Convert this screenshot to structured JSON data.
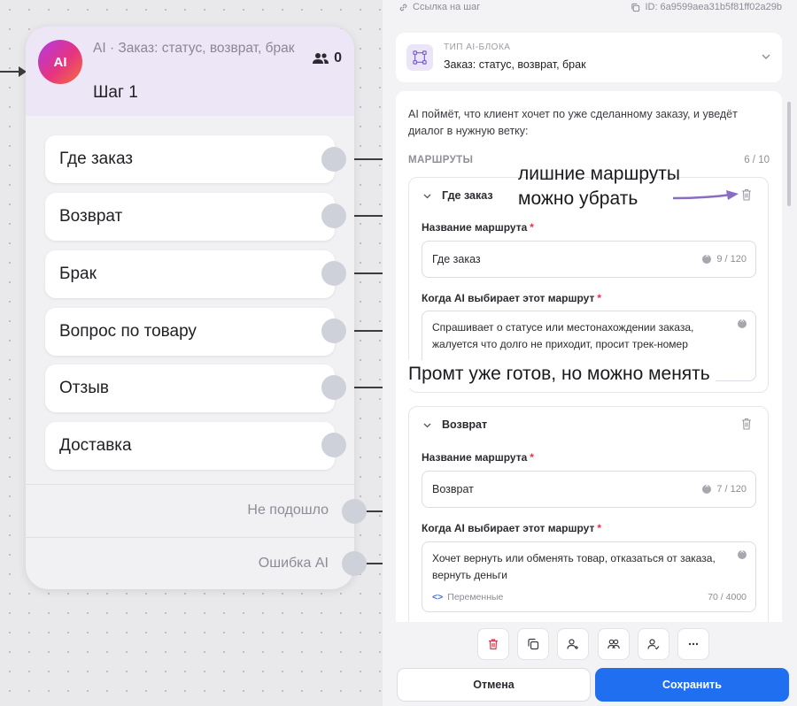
{
  "canvas": {
    "node": {
      "badge": "AI",
      "subtitle": "AI · Заказ: статус, возврат, брак",
      "title": "Шаг 1",
      "participants_count": "0",
      "routes": [
        "Где заказ",
        "Возврат",
        "Брак",
        "Вопрос по товару",
        "Отзыв",
        "Доставка"
      ],
      "fallback_no_match": "Не подошло",
      "fallback_error": "Ошибка AI"
    }
  },
  "panel": {
    "top_link": "Ссылка на шаг",
    "top_id": "ID: 6a9599aea31b5f81ff02a29b",
    "block_type": {
      "label": "ТИП AI-БЛОКА",
      "value": "Заказ: статус, возврат, брак",
      "icon": "node-tree-icon"
    },
    "description": "AI поймёт, что клиент хочет по уже сделанному заказу, и уведёт диалог в нужную ветку:",
    "routes_title": "МАРШРУТЫ",
    "routes_count": "6 / 10",
    "route_cards": [
      {
        "name": "Где заказ",
        "name_label": "Название маршрута",
        "name_value": "Где заказ",
        "name_counter": "9 / 120",
        "prompt_label": "Когда AI выбирает этот маршрут",
        "prompt_value": "Спрашивает о статусе или местонахождении заказа, жалуется что долго не приходит, просит трек-номер"
      },
      {
        "name": "Возврат",
        "name_label": "Название маршрута",
        "name_value": "Возврат",
        "name_counter": "7 / 120",
        "prompt_label": "Когда AI выбирает этот маршрут",
        "prompt_value": "Хочет вернуть или обменять товар, отказаться от заказа, вернуть деньги",
        "variables_label": "Переменные",
        "prompt_counter": "70 / 4000"
      }
    ],
    "toolbar_icons": [
      "trash-icon",
      "copy-icon",
      "assign-user-icon",
      "group-icon",
      "user-check-icon",
      "more-icon"
    ],
    "cancel_label": "Отмена",
    "save_label": "Сохранить"
  },
  "annotations": {
    "routes_hint": "лишние маршруты можно убрать",
    "prompt_hint": "Промт уже готов, но можно менять"
  },
  "colors": {
    "accent": "#1f6ff0",
    "node_header": "#ece6f6",
    "annotation_arrow": "#8a6cc4",
    "required": "#e5334b"
  }
}
